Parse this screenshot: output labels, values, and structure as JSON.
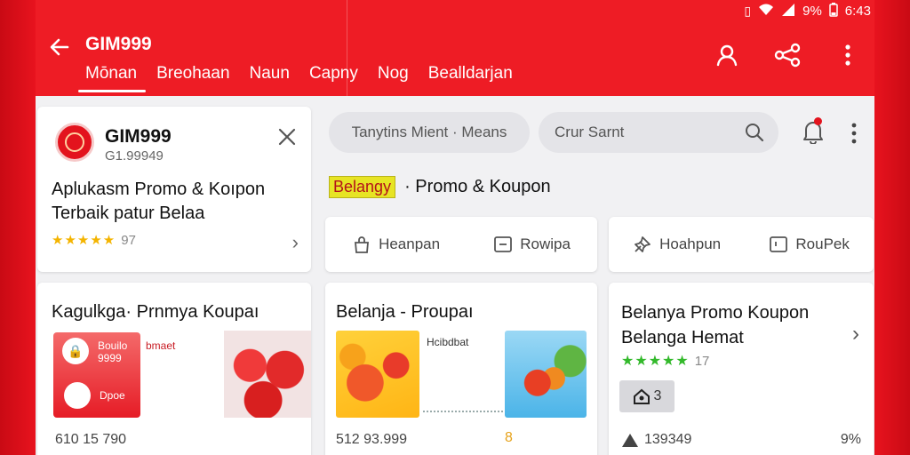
{
  "statusbar": {
    "battery": "9%",
    "time": "6:43"
  },
  "header": {
    "title": "GIM999",
    "tabs": [
      {
        "label": "Mōnan",
        "active": true
      },
      {
        "label": "Breohaan",
        "active": false
      },
      {
        "label": "Naun",
        "active": false
      },
      {
        "label": "Capny",
        "active": false
      },
      {
        "label": "Nog",
        "active": false
      },
      {
        "label": "Bealldarjan",
        "active": false
      }
    ],
    "icons": [
      "profile-icon",
      "share-icon",
      "more-vertical-icon"
    ]
  },
  "app_card": {
    "name": "GIM999",
    "subtitle": "G1.99949",
    "description": "Aplukasm Promo & Koıpon Terbaik patur Belaa",
    "stars": "★★★★★",
    "rating": "97"
  },
  "search": {
    "pill_a": "Tanytins  Mient · Means",
    "pill_b": "Crur  Sarnt"
  },
  "promo_line": {
    "highlight": "Belangy",
    "text": "· Promo & Koupon"
  },
  "actions_a": [
    {
      "icon": "bag-icon",
      "label": "Heanpan"
    },
    {
      "icon": "box-icon",
      "label": "Rowipa"
    }
  ],
  "actions_b": [
    {
      "icon": "pin-icon",
      "label": "Hoahpun"
    },
    {
      "icon": "box-icon",
      "label": "RouPek"
    }
  ],
  "promo_left": {
    "title": "Kagulkga· Prnmya Koupaı",
    "voucher_t1": "Bouilo",
    "voucher_t2": "9999",
    "voucher_t3": "Dpoe",
    "tag": "bmaet",
    "price": "610 15 790"
  },
  "promo_mid": {
    "title": "Belanja - Proupaı",
    "tag": "Hcibdbat",
    "price": "512 93.999",
    "coin": "8"
  },
  "promo_right": {
    "title": "Belanya Promo Koupon Belanga Hemat",
    "stars": "★★★★★",
    "rating": "17",
    "thumb_glyph": "3",
    "price": "139349",
    "pct": "9%"
  }
}
